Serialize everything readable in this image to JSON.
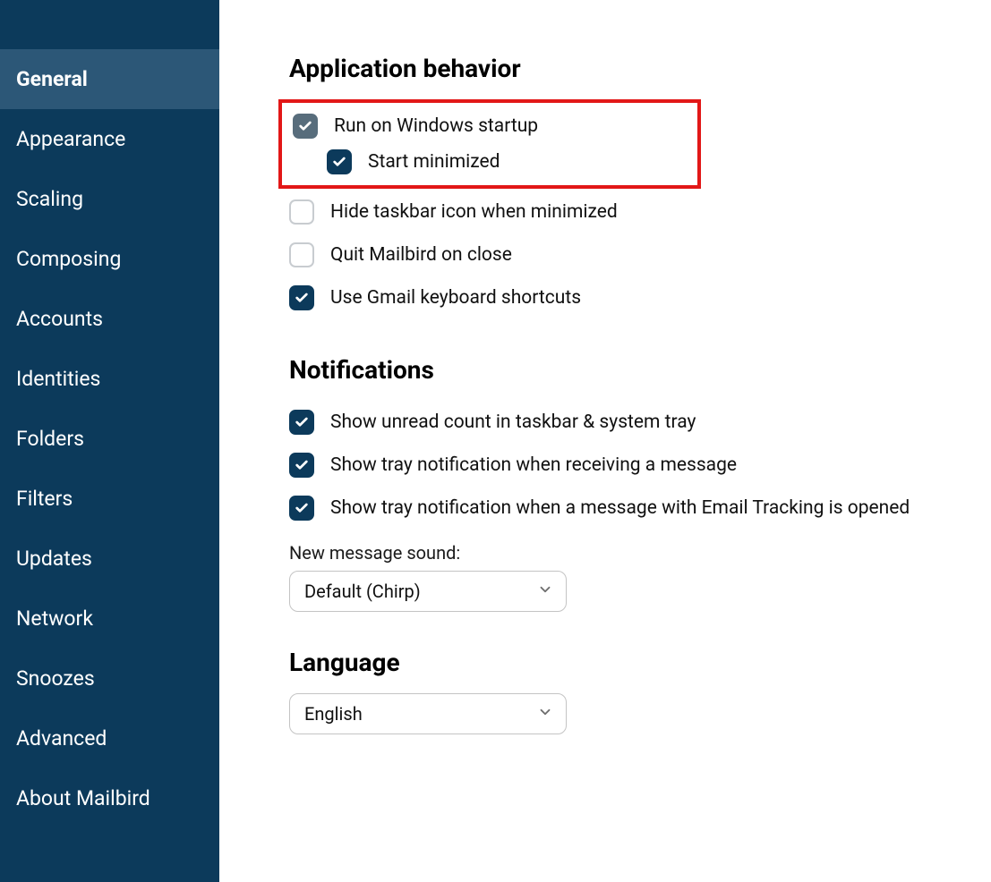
{
  "sidebar": {
    "selected_index": 0,
    "items": [
      {
        "label": "General"
      },
      {
        "label": "Appearance"
      },
      {
        "label": "Scaling"
      },
      {
        "label": "Composing"
      },
      {
        "label": "Accounts"
      },
      {
        "label": "Identities"
      },
      {
        "label": "Folders"
      },
      {
        "label": "Filters"
      },
      {
        "label": "Updates"
      },
      {
        "label": "Network"
      },
      {
        "label": "Snoozes"
      },
      {
        "label": "Advanced"
      },
      {
        "label": "About Mailbird"
      }
    ]
  },
  "sections": {
    "app_behavior": {
      "heading": "Application behavior",
      "options": {
        "run_on_startup": {
          "label": "Run on Windows startup",
          "checked": true,
          "style": "muted"
        },
        "start_minimized": {
          "label": "Start minimized",
          "checked": true,
          "style": "dark"
        },
        "hide_taskbar_icon": {
          "label": "Hide taskbar icon when minimized",
          "checked": false,
          "style": "none"
        },
        "quit_on_close": {
          "label": "Quit Mailbird on close",
          "checked": false,
          "style": "none"
        },
        "gmail_shortcuts": {
          "label": "Use Gmail keyboard shortcuts",
          "checked": true,
          "style": "dark"
        }
      }
    },
    "notifications": {
      "heading": "Notifications",
      "options": {
        "unread_count": {
          "label": "Show unread count in taskbar & system tray",
          "checked": true
        },
        "tray_on_receive": {
          "label": "Show tray notification when receiving a message",
          "checked": true
        },
        "tray_on_tracking": {
          "label": "Show tray notification when a message with Email Tracking is opened",
          "checked": true
        }
      },
      "sound_label": "New message sound:",
      "sound_value": "Default (Chirp)"
    },
    "language": {
      "heading": "Language",
      "value": "English"
    }
  }
}
